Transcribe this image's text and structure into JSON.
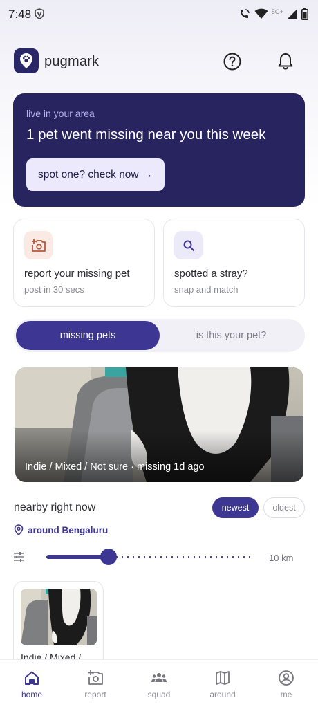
{
  "status": {
    "time": "7:48",
    "network": "5G+"
  },
  "app": {
    "name": "pugmark"
  },
  "banner": {
    "eyebrow": "live in your area",
    "title": "1 pet went missing near you this week",
    "cta": "spot one? check now",
    "cta_arrow": "→"
  },
  "actions": [
    {
      "title": "report your missing pet",
      "subtitle": "post in 30 secs",
      "icon": "camera-add-icon"
    },
    {
      "title": "spotted a stray?",
      "subtitle": "snap and match",
      "icon": "search-icon"
    }
  ],
  "tabs": {
    "active": "missing pets",
    "inactive": "is this your pet?"
  },
  "featured": {
    "caption": "Indie / Mixed / Not sure · missing 1d ago"
  },
  "nearby": {
    "title": "nearby right now",
    "sort_newest": "newest",
    "sort_oldest": "oldest",
    "location": "around Bengaluru",
    "radius_label": "10 km",
    "radius_fraction": 0.3
  },
  "pets": [
    {
      "label": "Indie / Mixed /"
    }
  ],
  "nav": [
    {
      "label": "home",
      "icon": "home-icon",
      "active": true
    },
    {
      "label": "report",
      "icon": "camera-add-icon"
    },
    {
      "label": "squad",
      "icon": "group-icon"
    },
    {
      "label": "around",
      "icon": "map-icon"
    },
    {
      "label": "me",
      "icon": "profile-icon"
    }
  ],
  "colors": {
    "primary": "#3d3793",
    "banner_bg": "#28245f",
    "accent_light": "#ebe9fb"
  }
}
